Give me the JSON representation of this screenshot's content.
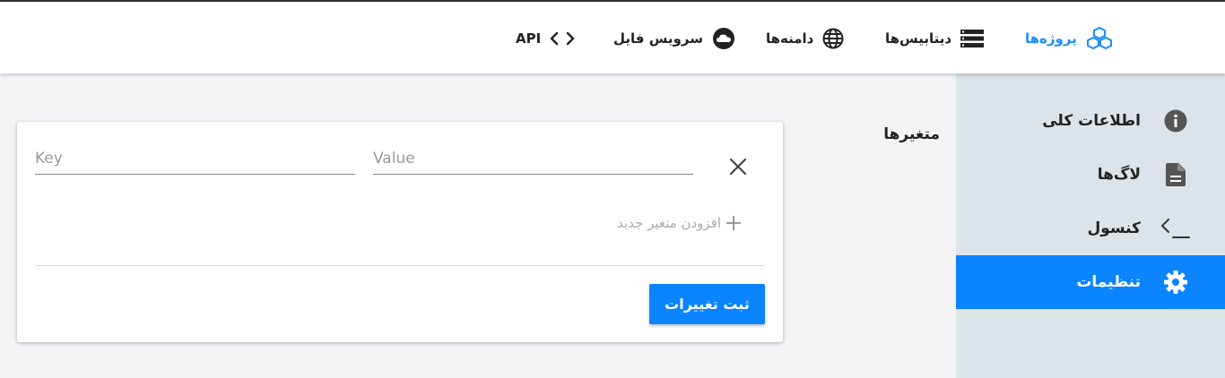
{
  "nav": {
    "projects": "پروژه‌ها",
    "databases": "دیتابیس‌ها",
    "domains": "دامنه‌ها",
    "file_service": "سرویس فایل",
    "api": "API"
  },
  "sidebar": {
    "items": [
      {
        "label": "اطلاعات کلی",
        "icon": "info-icon"
      },
      {
        "label": "لاگ‌ها",
        "icon": "document-icon"
      },
      {
        "label": "کنسول",
        "icon": "terminal-icon"
      },
      {
        "label": "تنظیمات",
        "icon": "gear-icon",
        "active": true
      }
    ]
  },
  "main": {
    "section_title": "متغیرها",
    "key_placeholder": "Key",
    "value_placeholder": "Value",
    "add_variable": "افزودن متغیر جدید",
    "save_label": "ثبت تغییرات"
  },
  "colors": {
    "accent": "#0a84ff",
    "sidebar_bg": "#dce3e9",
    "page_bg": "#f4f4f7"
  }
}
